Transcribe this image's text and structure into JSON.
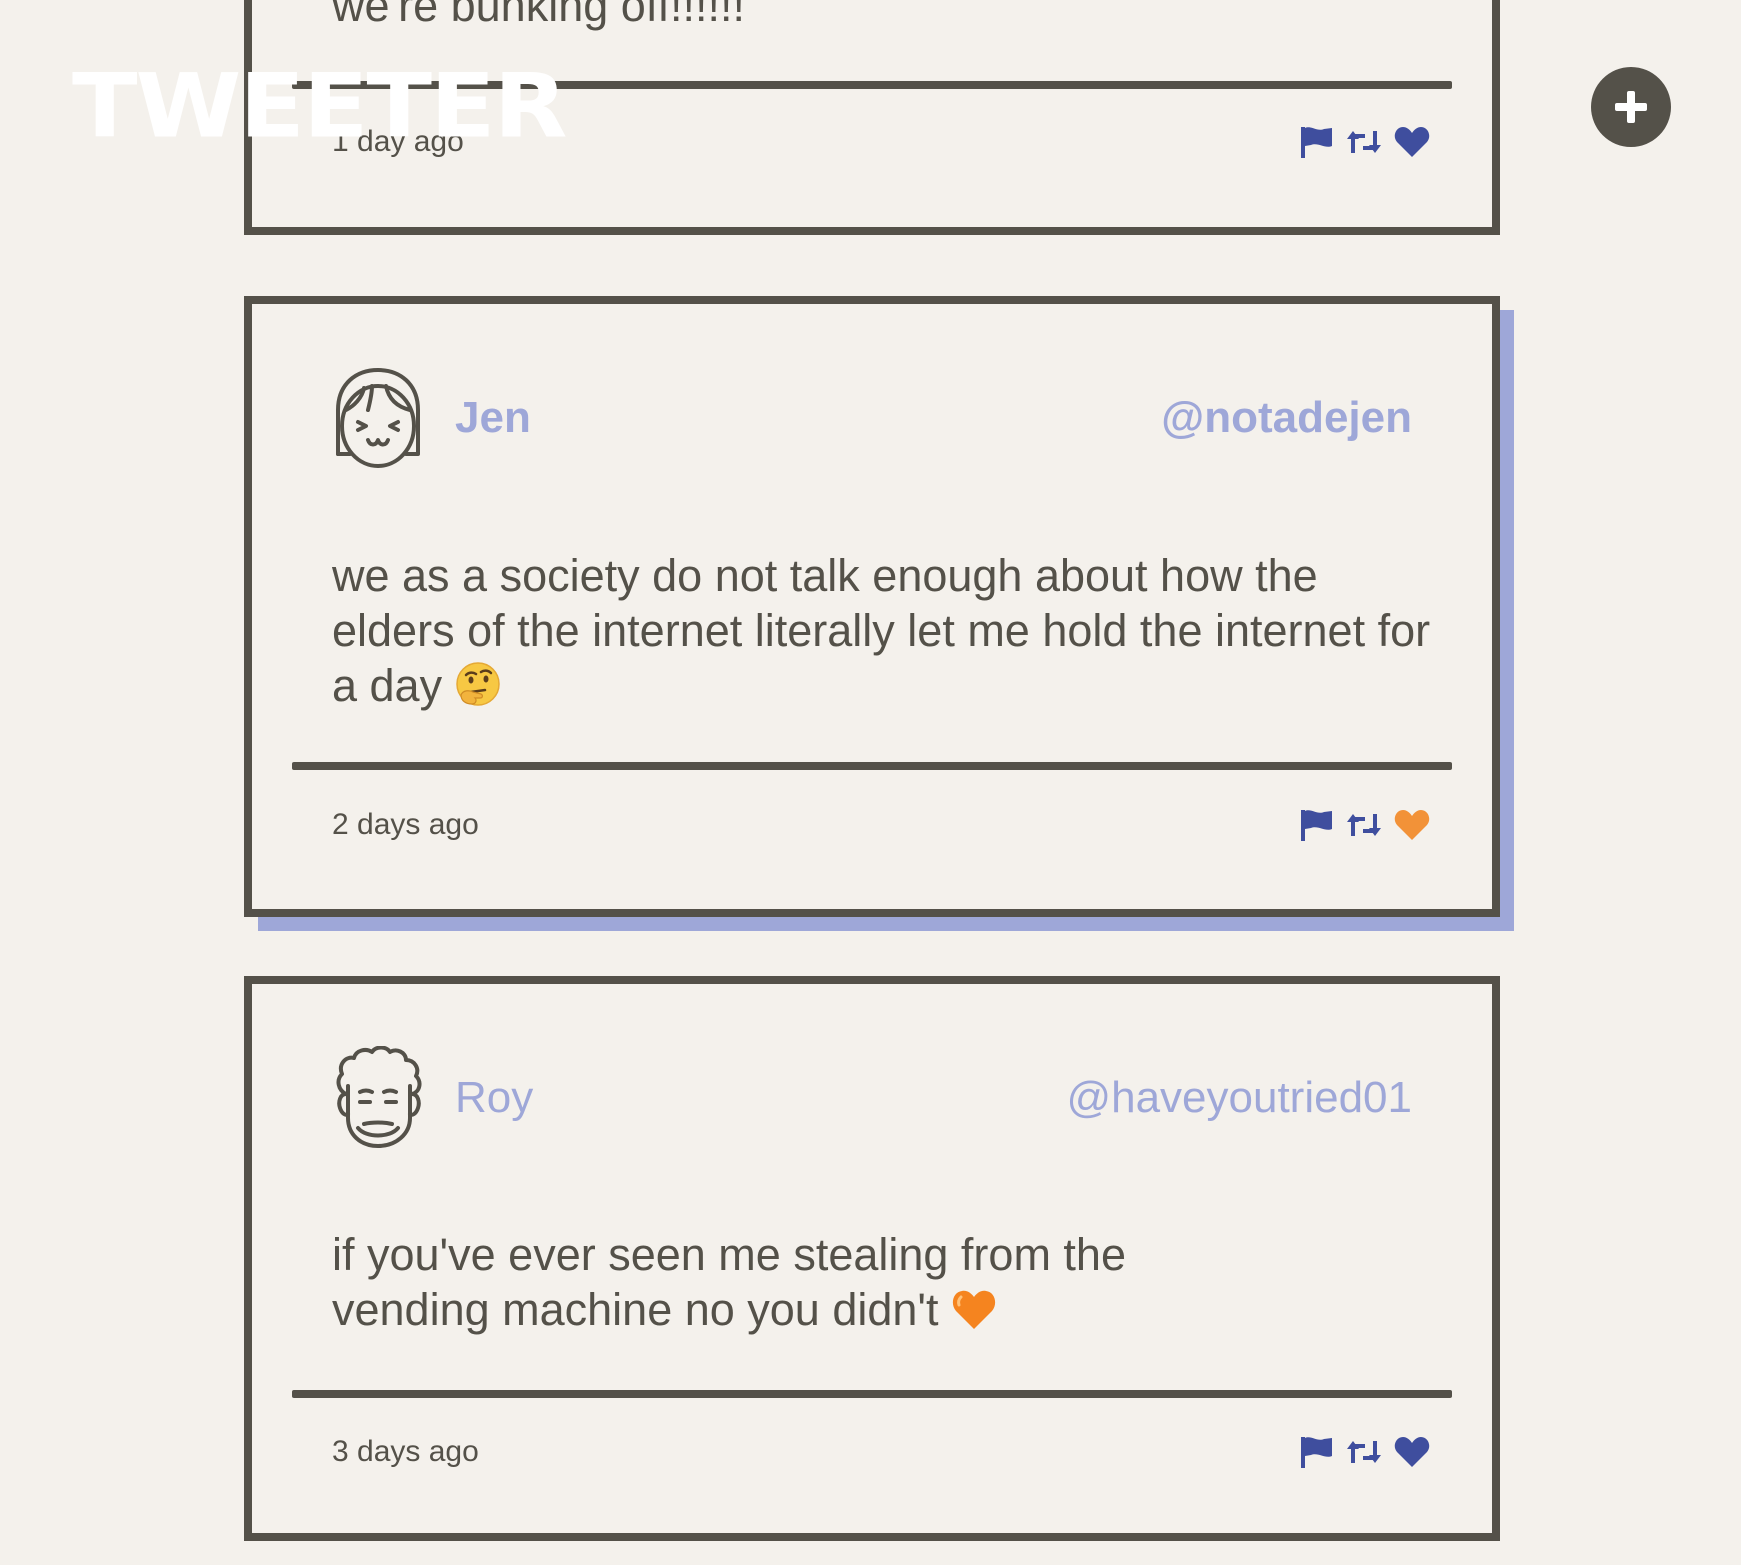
{
  "app": {
    "logo": "TWEETER"
  },
  "colors": {
    "text": "#545149",
    "accent": "#9ea7d8",
    "icon_blue": "#3f4e9e",
    "liked": "#f29238",
    "background": "#f4f1ec"
  },
  "compose": {
    "icon": "plus-icon"
  },
  "tweets": [
    {
      "body": "we're bunking off!!!!!!",
      "timestamp": "1 day ago",
      "liked": false
    },
    {
      "name": "Jen",
      "handle": "@notadejen",
      "avatar": "girl-avatar-icon",
      "body": "we as a society do not talk enough about how the elders of the internet literally let me hold the internet for a day",
      "emoji": "thinking-face-emoji",
      "timestamp": "2 days ago",
      "liked": true
    },
    {
      "name": "Roy",
      "handle": "@haveyoutried01",
      "avatar": "curly-hair-avatar-icon",
      "body": "if you've ever seen me stealing from the vending machine no you didn't",
      "emoji": "orange-heart-emoji",
      "timestamp": "3 days ago",
      "liked": false
    }
  ],
  "action_icons": [
    "flag-icon",
    "retweet-icon",
    "heart-icon"
  ]
}
